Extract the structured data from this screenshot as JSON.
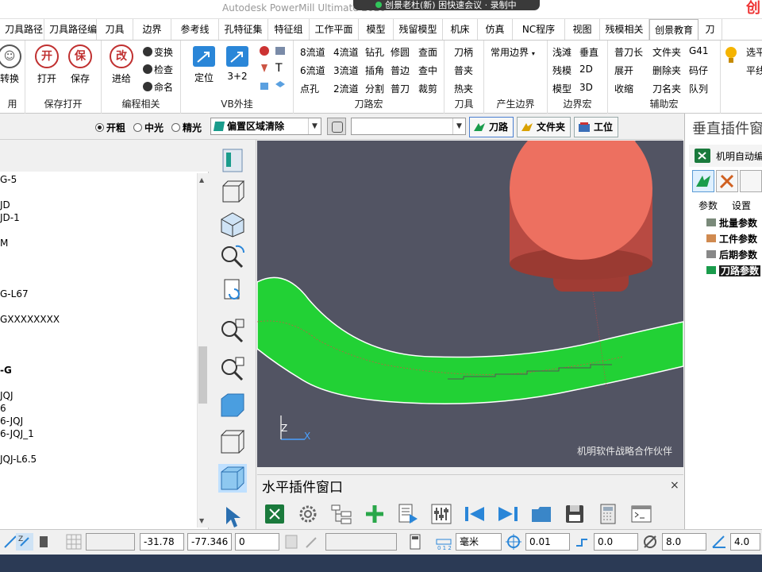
{
  "app": {
    "title": "Autodesk PowerMill Ultimate 2020"
  },
  "overlay": {
    "text": "创景老杜(新) 困快速会议",
    "status": "录制中"
  },
  "corner_logo": "创",
  "tabs": [
    "刀具路径",
    "刀具路径编",
    "刀具",
    "边界",
    "参考线",
    "孔特征集",
    "特征组",
    "工作平面",
    "模型",
    "残留模型",
    "机床",
    "仿真",
    "NC程序",
    "视图",
    "残模相关",
    "创景教育",
    "刀"
  ],
  "active_tab": "创景教育",
  "ribbon": {
    "g1": {
      "label": "用",
      "btn": "转换"
    },
    "g2": {
      "label": "保存打开",
      "open": "打开",
      "open_icon": "开",
      "save": "保存",
      "save_icon": "保"
    },
    "g3": {
      "label": "编程相关",
      "big": "进给",
      "big_icon": "改",
      "items": [
        "变换",
        "检查",
        "命名"
      ]
    },
    "g4": {
      "label": "VB外挂",
      "locate": "定位",
      "three_two": "3+2"
    },
    "g5": {
      "label": "刀路宏",
      "cells": [
        [
          "8流道",
          "4流道",
          "钻孔",
          "修圆",
          "查面"
        ],
        [
          "6流道",
          "3流道",
          "插角",
          "普边",
          "查中"
        ],
        [
          "点孔",
          "2流道",
          "分割",
          "普刀",
          "裁剪"
        ]
      ]
    },
    "g6": {
      "label": "刀具",
      "items": [
        "刀柄",
        "普夹",
        "热夹"
      ]
    },
    "g7": {
      "label": "产生边界",
      "item": "常用边界"
    },
    "g8": {
      "label": "边界宏",
      "cells": [
        [
          "浅滩",
          "垂直"
        ],
        [
          "残模",
          "2D"
        ],
        [
          "模型",
          "3D"
        ]
      ]
    },
    "g9": {
      "label": "辅助宏",
      "cells": [
        [
          "普刀长",
          "文件夹",
          "G41"
        ],
        [
          "展开",
          "删除夹",
          "码仔"
        ],
        [
          "收缩",
          "刀名夹",
          "队列"
        ]
      ]
    },
    "g10": {
      "items": [
        "选平",
        "平线"
      ]
    }
  },
  "options": {
    "radios": [
      "开粗",
      "中光",
      "精光"
    ],
    "selected": "开粗",
    "strategy": "偏置区域清除",
    "btn_toolpath": "刀路",
    "btn_folder": "文件夹",
    "btn_workpos": "工位"
  },
  "tree": [
    "G-5",
    "JD",
    "JD-1",
    "M",
    "G-L67",
    "GXXXXXXXX",
    "-G",
    "JQJ",
    "6",
    "6-JQJ",
    "6-JQJ_1",
    "JQJ-L6.5"
  ],
  "viewport": {
    "watermark": "机明软件战略合作伙伴"
  },
  "hplugin": {
    "title": "水平插件窗口",
    "close": "×"
  },
  "vplugin": {
    "title": "垂直插件窗",
    "subtitle": "机明自动编",
    "subtabs": [
      "参数",
      "设置"
    ],
    "items": [
      "批量参数",
      "工件参数",
      "后期参数",
      "刀路参数"
    ]
  },
  "status": {
    "x": "-31.78",
    "y": "-77.346",
    "z": "0",
    "unit": "毫米",
    "tol": "0.01",
    "thick": "0.0",
    "dia": "8.0",
    "val": "4.0"
  },
  "colors": {
    "accent_red": "#c03030",
    "mesh_green": "#22d135",
    "viewport_bg": "#525463",
    "tool_red": "#e87060"
  }
}
